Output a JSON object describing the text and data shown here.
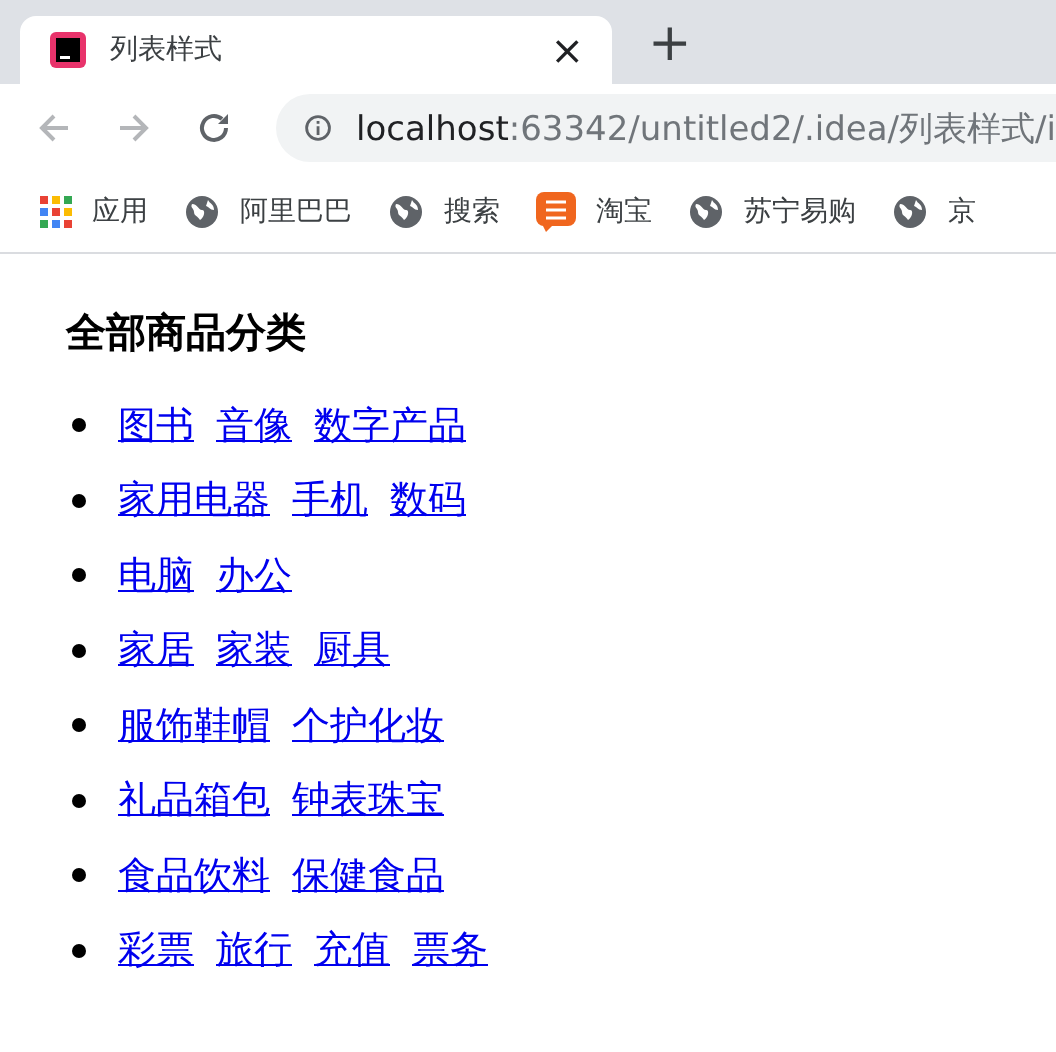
{
  "tab": {
    "title": "列表样式",
    "close": "×",
    "new_tab": "+"
  },
  "address": {
    "host": "localhost",
    "rest": ":63342/untitled2/.idea/列表样式/i"
  },
  "bookmarks": [
    {
      "kind": "apps",
      "label": "应用"
    },
    {
      "kind": "globe",
      "label": "阿里巴巴"
    },
    {
      "kind": "globe",
      "label": "搜索"
    },
    {
      "kind": "taobao",
      "label": "淘宝"
    },
    {
      "kind": "globe",
      "label": "苏宁易购"
    },
    {
      "kind": "globe",
      "label": "京"
    }
  ],
  "heading": "全部商品分类",
  "list": [
    [
      "图书",
      "音像",
      "数字产品"
    ],
    [
      "家用电器",
      "手机",
      "数码"
    ],
    [
      "电脑",
      "办公"
    ],
    [
      "家居",
      "家装",
      "厨具"
    ],
    [
      "服饰鞋帽",
      "个护化妆"
    ],
    [
      "礼品箱包",
      "钟表珠宝"
    ],
    [
      "食品饮料",
      "保健食品"
    ],
    [
      "彩票",
      "旅行",
      "充值",
      "票务"
    ]
  ]
}
